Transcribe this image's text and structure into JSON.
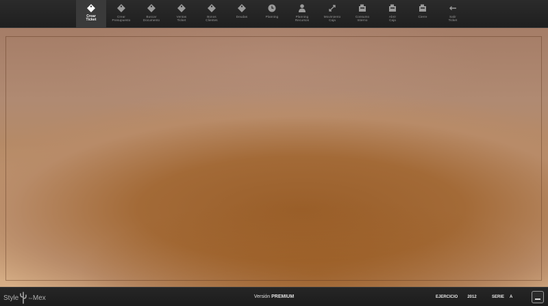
{
  "toolbar": {
    "items": [
      {
        "label": "Crear\nTicket",
        "icon": "tag-icon",
        "active": true
      },
      {
        "label": "Crear\nPresupuesto",
        "icon": "tag-icon"
      },
      {
        "label": "Buscar\nDocumento",
        "icon": "tag-icon"
      },
      {
        "label": "Ventas\nTicket",
        "icon": "tag-icon"
      },
      {
        "label": "Bonos\nClientes",
        "icon": "tag-icon"
      },
      {
        "label": "Deudas",
        "icon": "tag-icon"
      },
      {
        "label": "Planning",
        "icon": "clock-icon"
      },
      {
        "label": "Planning\nRecursos",
        "icon": "person-icon"
      },
      {
        "label": "Movimiento\nCaja",
        "icon": "transfer-icon"
      },
      {
        "label": "Consumo\nInterno",
        "icon": "register-icon"
      },
      {
        "label": "Abrir\nCaja",
        "icon": "register-icon"
      },
      {
        "label": "Cierre",
        "icon": "register-icon"
      },
      {
        "label": "Salir\nTicket",
        "icon": "exit-arrow-icon"
      }
    ]
  },
  "status": {
    "logo_left": "Style",
    "logo_small": "for",
    "logo_right": "Mex",
    "version_prefix": "Versión",
    "version_name": "PREMIUM",
    "ejercicio_label": "EJERCICIO",
    "ejercicio_value": "2012",
    "serie_label": "SERIE",
    "serie_value": "A",
    "minimize_icon": "minimize-icon"
  }
}
